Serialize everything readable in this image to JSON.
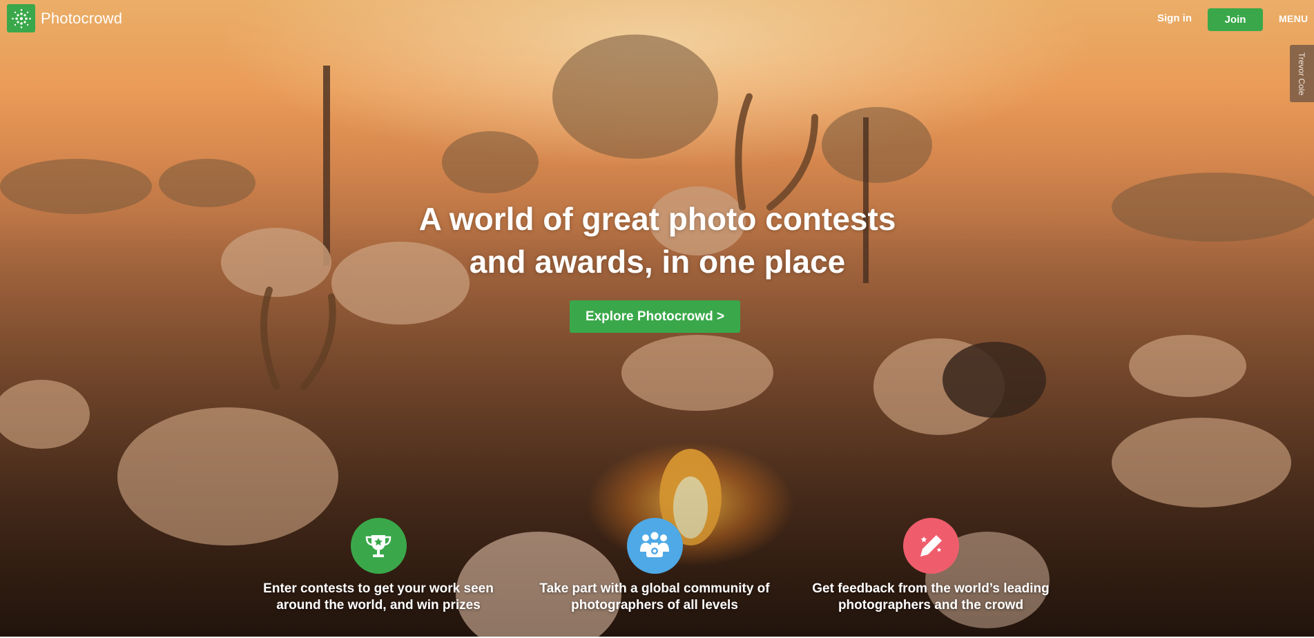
{
  "brand": {
    "name": "Photocrowd",
    "color": "#3aa84a",
    "logo_icon": "photocrowd-dots-icon"
  },
  "header": {
    "signin_label": "Sign in",
    "join_label": "Join",
    "menu_label": "MENU"
  },
  "photo_credit": "Trevor Cole",
  "hero": {
    "headline_line1": "A world of great photo contests",
    "headline_line2": "and awards, in one place",
    "cta_label": "Explore Photocrowd >"
  },
  "features": [
    {
      "icon": "trophy-icon",
      "color": "#3aa84a",
      "line1": "Enter contests to get your work seen",
      "line2": "around the world, and win prizes"
    },
    {
      "icon": "community-camera-icon",
      "color": "#4ea9e6",
      "line1": "Take part with a global community of",
      "line2": "photographers of all levels"
    },
    {
      "icon": "feedback-pen-icon",
      "color": "#ef5d6c",
      "line1": "Get feedback from the world’s leading",
      "line2": "photographers and the crowd"
    }
  ]
}
